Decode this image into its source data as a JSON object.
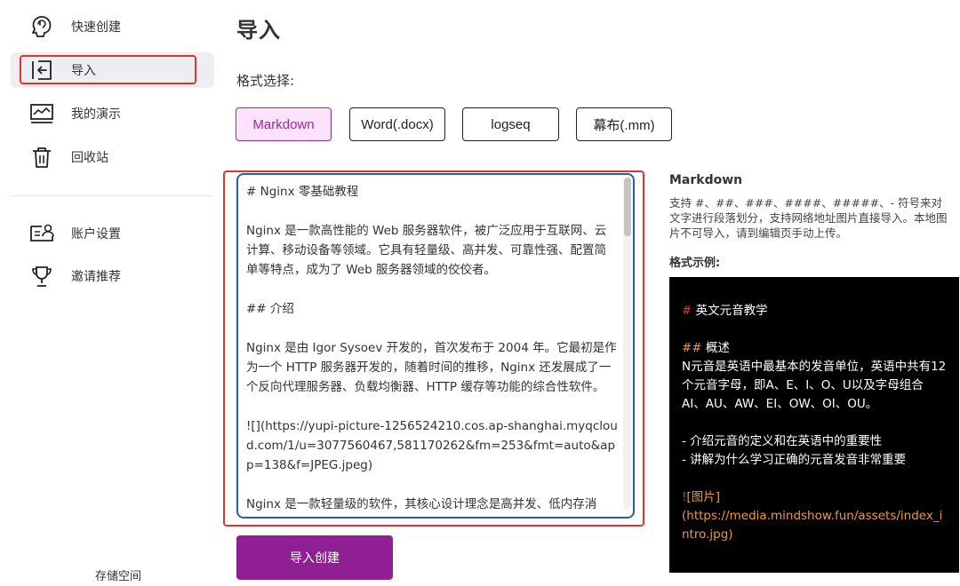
{
  "sidebar": {
    "items": [
      {
        "label": "快速创建",
        "icon": "brain-icon"
      },
      {
        "label": "导入",
        "icon": "import-icon"
      },
      {
        "label": "我的演示",
        "icon": "presentation-icon"
      },
      {
        "label": "回收站",
        "icon": "trash-icon"
      },
      {
        "label": "账户设置",
        "icon": "account-icon"
      },
      {
        "label": "邀请推荐",
        "icon": "trophy-icon"
      }
    ],
    "storage_label": "存储空间"
  },
  "main": {
    "title": "导入",
    "format_label": "格式选择:",
    "formats": [
      "Markdown",
      "Word(.docx)",
      "logseq",
      "幕布(.mm)"
    ],
    "selected_format": "Markdown",
    "editor": {
      "value": "# Nginx 零基础教程\n\nNginx 是一款高性能的 Web 服务器软件，被广泛应用于互联网、云计算、移动设备等领域。它具有轻量级、高并发、可靠性强、配置简单等特点，成为了 Web 服务器领域的佼佼者。\n\n## 介绍\n\nNginx 是由 Igor Sysoev 开发的，首次发布于 2004 年。它最初是作为一个 HTTP 服务器开发的，随着时间的推移，Nginx 还发展成了一个反向代理服务器、负载均衡器、HTTP 缓存等功能的综合性软件。\n\n![](https://yupi-picture-1256524210.cos.ap-shanghai.myqcloud.com/1/u=3077560467,581170262&fm=253&fmt=auto&app=138&f=JPEG.jpeg)\n\nNginx 是一款轻量级的软件，其核心设计理念是高并发、低内存消耗、稳定性和可靠性。Nginx 的线程处理机制采用异步非阻塞事件驱"
    },
    "submit_label": "导入创建"
  },
  "help": {
    "title": "Markdown",
    "description": "支持 #、##、###、####、#####、- 符号来对文字进行段落划分，支持网络地址图片直接导入。本地图片不可导入，请到编辑页手动上传。",
    "example_label": "格式示例:",
    "example": {
      "h1_mark": "#",
      "h1_text": " 英文元音教学",
      "h2_mark": "##",
      "h2_text": " 概述",
      "para": " N元音是英语中最基本的发音单位，英语中共有12个元音字母，即A、E、I、O、U以及字母组合AI、AU、AW、EI、OW、OI、OU。",
      "bullet1": "- 介绍元音的定义和在英语中的重要性",
      "bullet2": "- 讲解为什么学习正确的元音发音非常重要",
      "img_mark": "!",
      "img_alt": "[图片]",
      "img_url": "(https://media.mindshow.fun/assets/index_intro.jpg)"
    }
  },
  "colors": {
    "accent": "#8f1f92",
    "selected_bg": "#fbe3fb",
    "annotation": "#e8322d",
    "editor_border": "#2a5da8"
  }
}
